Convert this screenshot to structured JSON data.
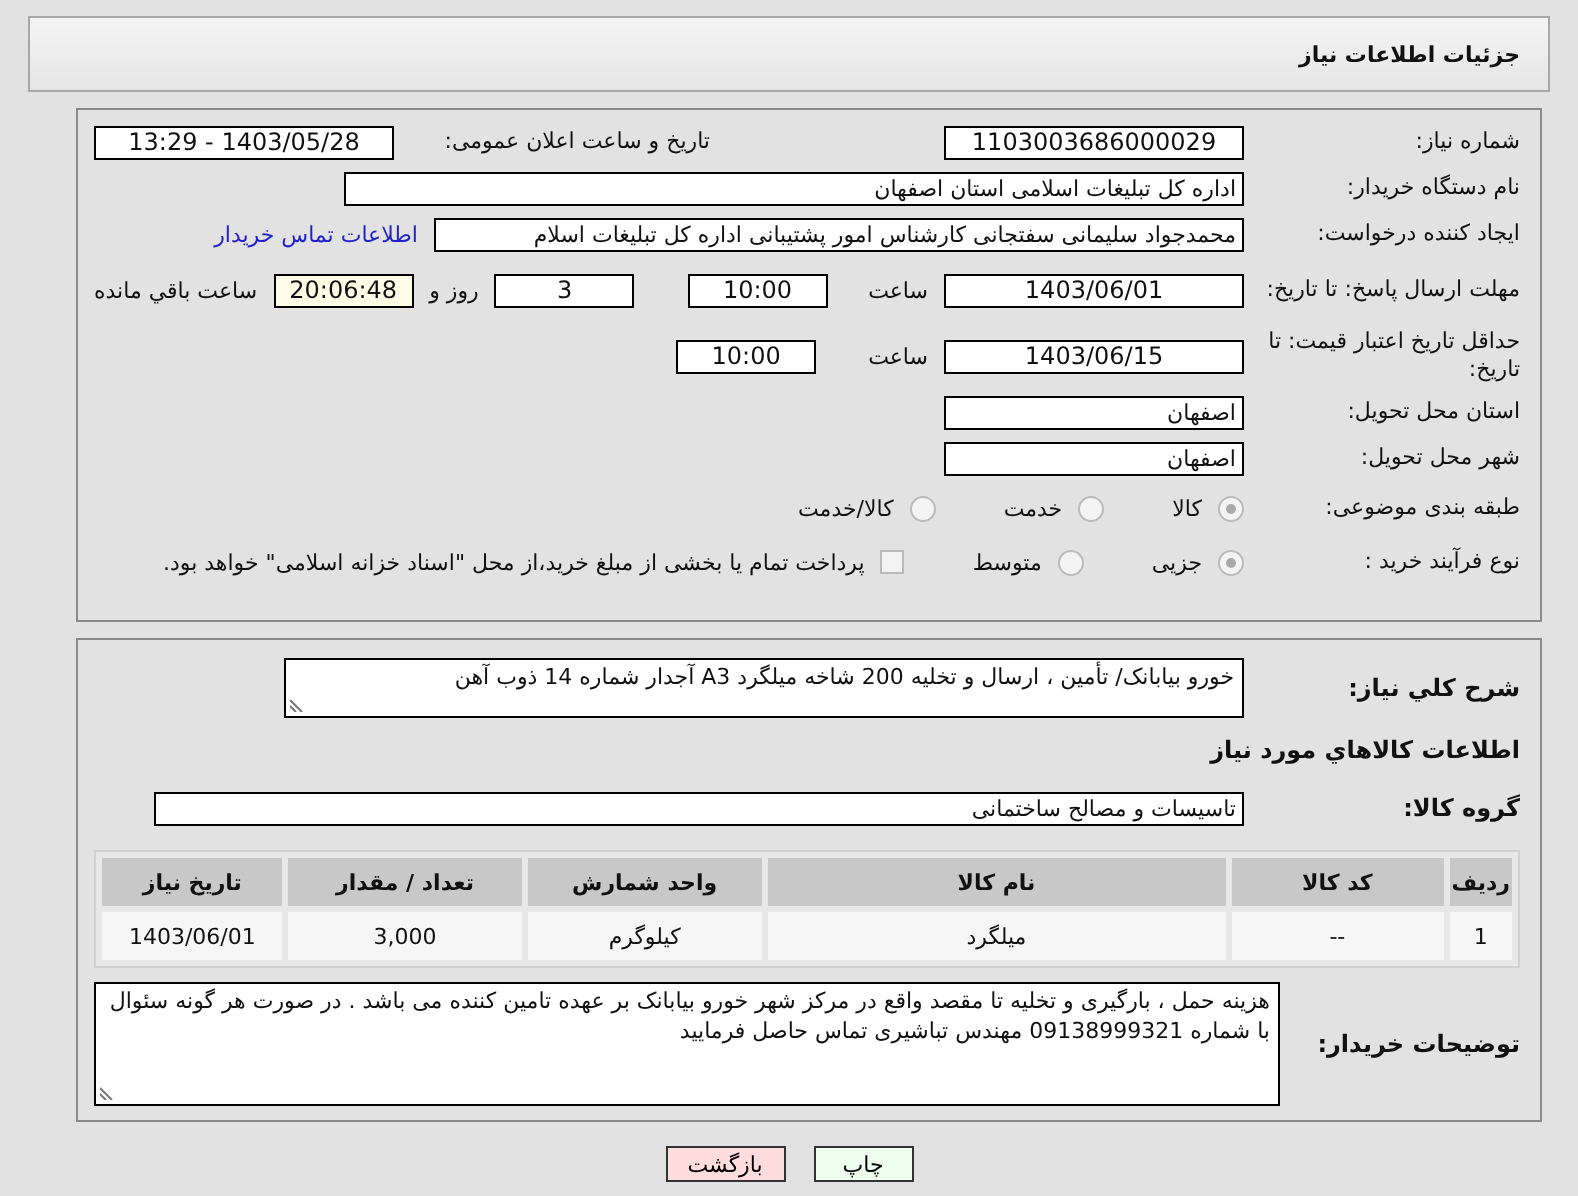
{
  "header": {
    "title": "جزئیات اطلاعات نیاز"
  },
  "need_number": {
    "label": "شماره نیاز:",
    "value": "1103003686000029"
  },
  "announce": {
    "label": "تاریخ و ساعت اعلان عمومی:",
    "value": "1403/05/28 - 13:29"
  },
  "buyer": {
    "label": "نام دستگاه خریدار:",
    "value": "اداره کل تبلیغات اسلامی استان اصفهان"
  },
  "creator": {
    "label": "ایجاد کننده درخواست:",
    "value": "محمدجواد سلیمانی سفتجانی کارشناس امور پشتیبانی اداره کل تبلیغات اسلام",
    "link": "اطلاعات تماس خریدار"
  },
  "deadline": {
    "label": "مهلت ارسال پاسخ: تا تاریخ:",
    "date": "1403/06/01",
    "time_label": "ساعت",
    "time": "10:00",
    "days": "3",
    "days_label": "روز و",
    "remaining": "20:06:48",
    "remaining_label": "ساعت باقي مانده"
  },
  "validity": {
    "label": "حداقل تاریخ اعتبار قیمت: تا تاریخ:",
    "date": "1403/06/15",
    "time_label": "ساعت",
    "time": "10:00"
  },
  "province": {
    "label": "استان محل تحویل:",
    "value": "اصفهان"
  },
  "city": {
    "label": "شهر محل تحویل:",
    "value": "اصفهان"
  },
  "category": {
    "label": "طبقه بندی موضوعی:",
    "options": [
      {
        "label": "کالا",
        "selected": true
      },
      {
        "label": "خدمت",
        "selected": false
      },
      {
        "label": "کالا/خدمت",
        "selected": false
      }
    ]
  },
  "process": {
    "label": "نوع فرآیند خرید :",
    "options": [
      {
        "label": "جزیی",
        "selected": true
      },
      {
        "label": "متوسط",
        "selected": false
      }
    ],
    "payment": {
      "checked": false,
      "text": "پرداخت تمام یا بخشی از مبلغ خرید،از محل \"اسناد خزانه اسلامی\" خواهد بود."
    }
  },
  "summary": {
    "label": "شرح کلي نياز:",
    "value": "خورو بیابانک/ تأمین ، ارسال و تخلیه 200 شاخه میلگرد A3 آجدار شماره 14 ذوب آهن"
  },
  "goods_heading": "اطلاعات کالاهاي مورد نياز",
  "goods_group": {
    "label": "گروه کالا:",
    "value": "تاسیسات و مصالح ساختمانی"
  },
  "table": {
    "columns": [
      "رديف",
      "کد کالا",
      "نام کالا",
      "واحد شمارش",
      "تعداد / مقدار",
      "تاریخ نیاز"
    ],
    "rows": [
      [
        "1",
        "--",
        "میلگرد",
        "کیلوگرم",
        "3,000",
        "1403/06/01"
      ]
    ]
  },
  "buyer_notes": {
    "label": "توضیحات خریدار:",
    "value": "هزینه حمل ، بارگیری و تخلیه تا مقصد واقع در مرکز شهر خورو بیابانک بر عهده تامین کننده می باشد . در صورت هر گونه سئوال با شماره 09138999321 مهندس تباشیری تماس حاصل فرمایید"
  },
  "buttons": [
    {
      "label": "چاپ",
      "kind": "print"
    },
    {
      "label": "بازگشت",
      "kind": "back"
    }
  ]
}
